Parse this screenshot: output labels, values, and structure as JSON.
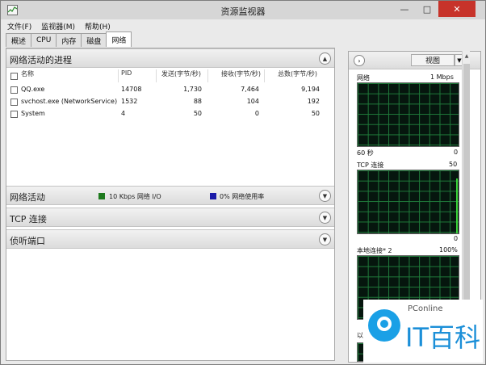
{
  "window": {
    "title": "资源监视器"
  },
  "menu": {
    "file": "文件(F)",
    "monitor": "监视器(M)",
    "help": "帮助(H)"
  },
  "tabs": [
    "概述",
    "CPU",
    "内存",
    "磁盘",
    "网络"
  ],
  "processes": {
    "title": "网络活动的进程",
    "columns": {
      "name": "名称",
      "pid": "PID",
      "send": "发送(字节/秒)",
      "recv": "接收(字节/秒)",
      "total": "总数(字节/秒)"
    },
    "rows": [
      {
        "name": "QQ.exe",
        "pid": "14708",
        "send": "1,730",
        "recv": "7,464",
        "total": "9,194"
      },
      {
        "name": "svchost.exe (NetworkService)",
        "pid": "1532",
        "send": "88",
        "recv": "104",
        "total": "192"
      },
      {
        "name": "System",
        "pid": "4",
        "send": "50",
        "recv": "0",
        "total": "50"
      }
    ]
  },
  "network_activity": {
    "title": "网络活动",
    "io_label": "10 Kbps 网络 I/O",
    "usage_label": "0% 网络使用率",
    "io_color": "#1e7a1e",
    "usage_color": "#1a1aa8"
  },
  "tcp": {
    "title": "TCP 连接"
  },
  "listen": {
    "title": "侦听端口"
  },
  "right_panel": {
    "view_label": "视图",
    "graphs": [
      {
        "label": "网络",
        "scale": "1 Mbps",
        "time": "60 秒",
        "min": "0"
      },
      {
        "label": "TCP 连接",
        "scale": "50",
        "min": "0"
      },
      {
        "label": "本地连接* 2",
        "scale": "100%",
        "bottom_label": "以"
      }
    ]
  },
  "watermark": {
    "sub": "PConline",
    "main": "IT百科"
  }
}
